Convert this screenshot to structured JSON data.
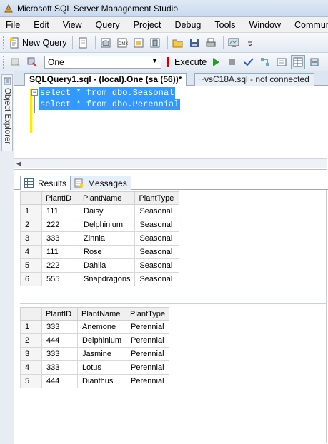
{
  "window": {
    "title": "Microsoft SQL Server Management Studio"
  },
  "menu": [
    "File",
    "Edit",
    "View",
    "Query",
    "Project",
    "Debug",
    "Tools",
    "Window",
    "Community"
  ],
  "toolbar1": {
    "new_query_label": "New Query"
  },
  "toolbar2": {
    "database": "One",
    "execute_label": "Execute"
  },
  "side_panel": {
    "object_explorer_label": "Object Explorer"
  },
  "doc_tabs": [
    {
      "label": "SQLQuery1.sql - (local).One (sa (56))*"
    },
    {
      "label": "~vsC18A.sql - not connected"
    }
  ],
  "editor": {
    "lines": [
      "select * from dbo.Seasonal",
      "select * from dbo.Perennial"
    ]
  },
  "results_tabs": [
    {
      "label": "Results"
    },
    {
      "label": "Messages"
    }
  ],
  "result1": {
    "columns": [
      "PlantID",
      "PlantName",
      "PlantType"
    ],
    "rows": [
      {
        "n": "1",
        "id": "111",
        "name": "Daisy",
        "type": "Seasonal"
      },
      {
        "n": "2",
        "id": "222",
        "name": "Delphinium",
        "type": "Seasonal"
      },
      {
        "n": "3",
        "id": "333",
        "name": "Zinnia",
        "type": "Seasonal"
      },
      {
        "n": "4",
        "id": "111",
        "name": "Rose",
        "type": "Seasonal"
      },
      {
        "n": "5",
        "id": "222",
        "name": "Dahlia",
        "type": "Seasonal"
      },
      {
        "n": "6",
        "id": "555",
        "name": "Snapdragons",
        "type": "Seasonal"
      }
    ]
  },
  "result2": {
    "columns": [
      "PlantID",
      "PlantName",
      "PlantType"
    ],
    "rows": [
      {
        "n": "1",
        "id": "333",
        "name": "Anemone",
        "type": "Perennial"
      },
      {
        "n": "2",
        "id": "444",
        "name": "Delphinium",
        "type": "Perennial"
      },
      {
        "n": "3",
        "id": "333",
        "name": "Jasmine",
        "type": "Perennial"
      },
      {
        "n": "4",
        "id": "333",
        "name": "Lotus",
        "type": "Perennial"
      },
      {
        "n": "5",
        "id": "444",
        "name": "Dianthus",
        "type": "Perennial"
      }
    ]
  },
  "colors": {
    "selection": "#3399ff",
    "change_marker": "#ffea00",
    "execute_icon": "#cc0000"
  }
}
